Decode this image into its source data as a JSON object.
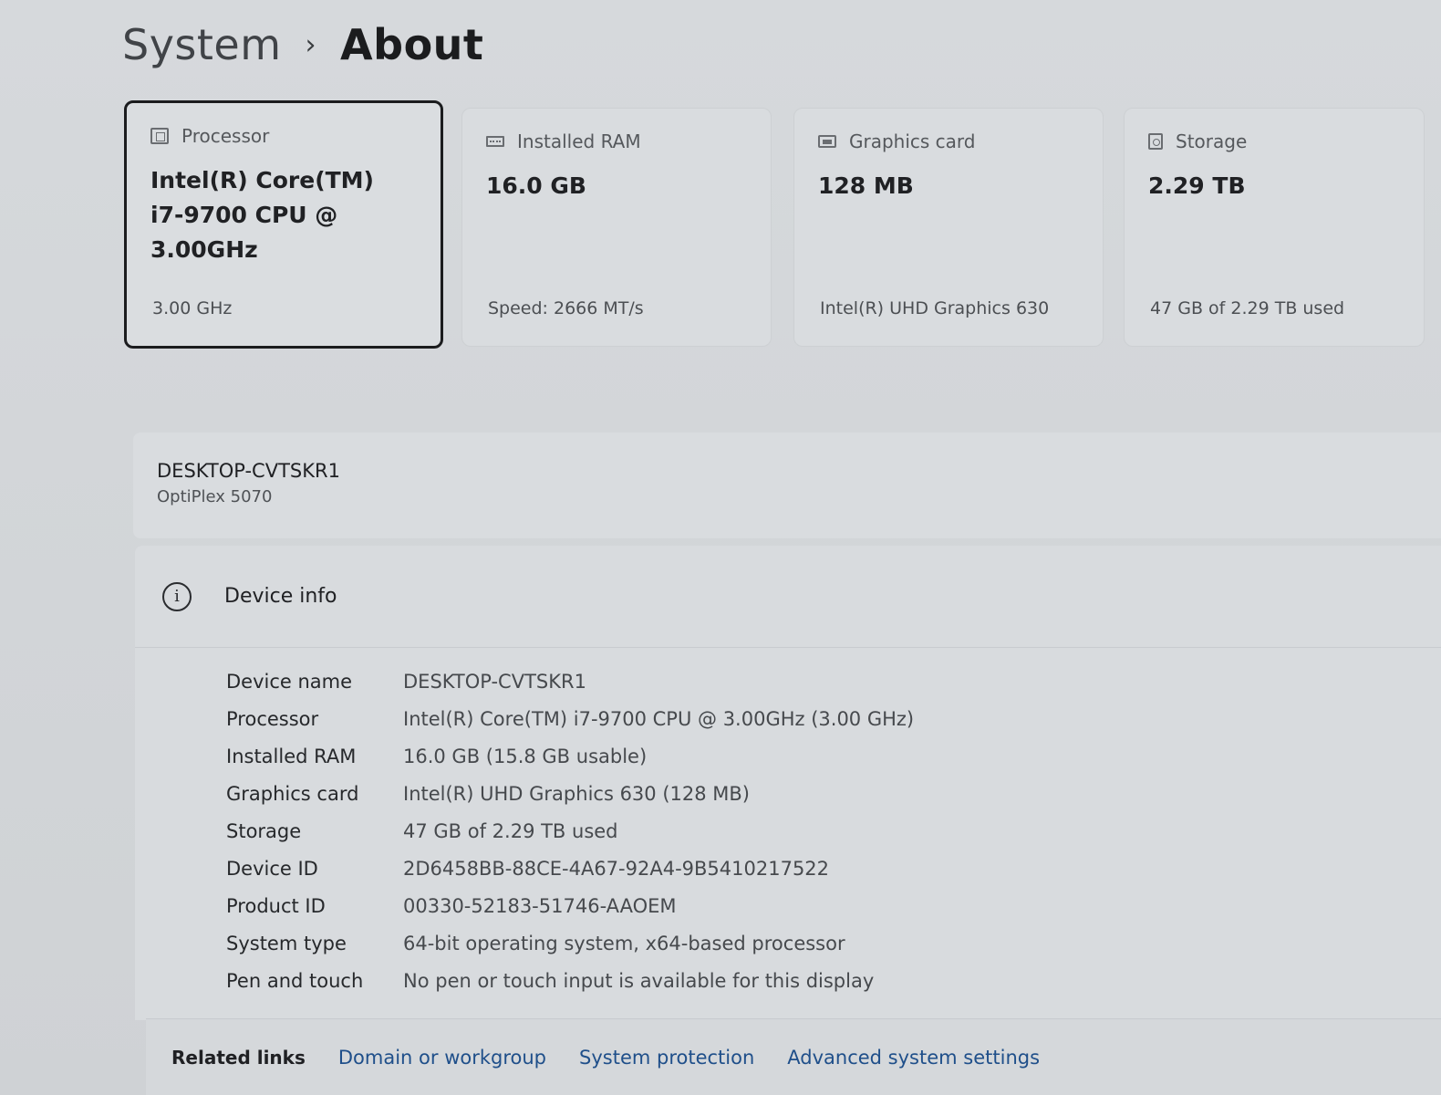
{
  "breadcrumb": {
    "parent": "System",
    "separator": "›",
    "current": "About"
  },
  "cards": [
    {
      "icon": "processor-icon",
      "title": "Processor",
      "value": "Intel(R) Core(TM) i7-9700 CPU @ 3.00GHz",
      "value_lines": [
        "Intel(R) Core(TM)",
        "i7-9700 CPU @",
        "3.00GHz"
      ],
      "sub": "3.00 GHz"
    },
    {
      "icon": "ram-icon",
      "title": "Installed RAM",
      "value": "16.0 GB",
      "sub": "Speed: 2666 MT/s"
    },
    {
      "icon": "graphics-card-icon",
      "title": "Graphics card",
      "value": "128 MB",
      "sub": "Intel(R) UHD Graphics 630"
    },
    {
      "icon": "storage-icon",
      "title": "Storage",
      "value": "2.29 TB",
      "sub": "47 GB of 2.29 TB used"
    }
  ],
  "device": {
    "name": "DESKTOP-CVTSKR1",
    "model": "OptiPlex 5070"
  },
  "device_info": {
    "title": "Device info",
    "rows": [
      {
        "key": "Device name",
        "value": "DESKTOP-CVTSKR1"
      },
      {
        "key": "Processor",
        "value": "Intel(R) Core(TM) i7-9700 CPU @ 3.00GHz (3.00 GHz)"
      },
      {
        "key": "Installed RAM",
        "value": "16.0 GB (15.8 GB usable)"
      },
      {
        "key": "Graphics card",
        "value": "Intel(R) UHD Graphics 630 (128 MB)"
      },
      {
        "key": "Storage",
        "value": "47 GB of 2.29 TB used"
      },
      {
        "key": "Device ID",
        "value": "2D6458BB-88CE-4A67-92A4-9B5410217522"
      },
      {
        "key": "Product ID",
        "value": "00330-52183-51746-AAOEM"
      },
      {
        "key": "System type",
        "value": "64-bit operating system, x64-based processor"
      },
      {
        "key": "Pen and touch",
        "value": "No pen or touch input is available for this display"
      }
    ]
  },
  "related_links": {
    "title": "Related links",
    "links": [
      "Domain or workgroup",
      "System protection",
      "Advanced system settings"
    ]
  }
}
